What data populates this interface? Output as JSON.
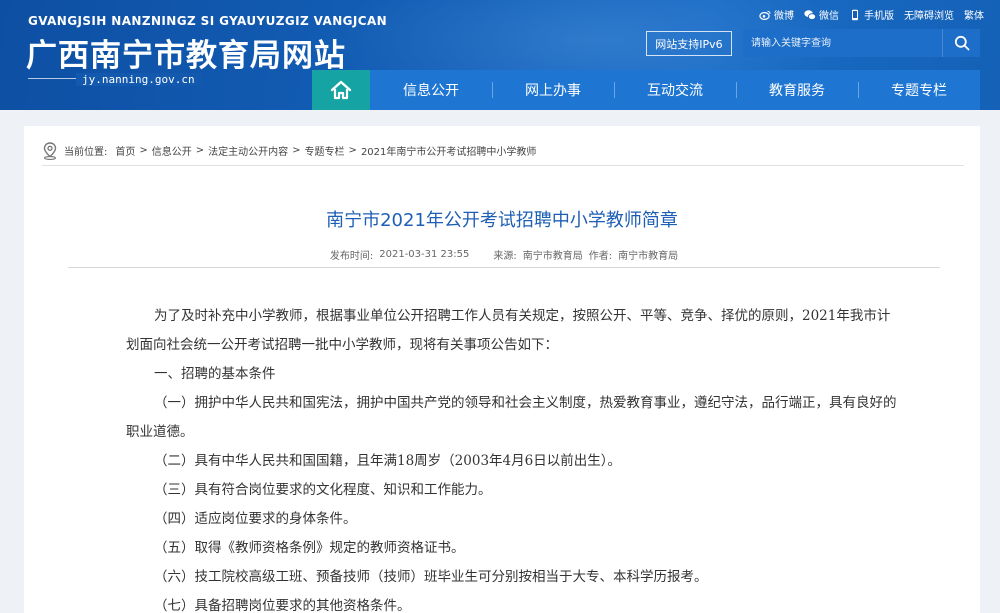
{
  "header": {
    "pinyin": "GVANGJSIH NANZNINGZ SI GYAUYUZGIZ VANGJCAN",
    "title": "广西南宁市教育局网站",
    "domain": "jy.nanning.gov.cn",
    "toplinks": [
      {
        "label": "微博",
        "icon": "weibo-icon"
      },
      {
        "label": "微信",
        "icon": "wechat-icon"
      },
      {
        "label": "手机版",
        "icon": "mobile-icon"
      },
      {
        "label": "无障碍浏览"
      },
      {
        "label": "繁体"
      }
    ],
    "ipv6": "网站支持IPv6",
    "search_placeholder": "请输入关键字查询"
  },
  "nav": {
    "home_icon": "home-icon",
    "items": [
      "信息公开",
      "网上办事",
      "互动交流",
      "教育服务",
      "专题专栏"
    ]
  },
  "breadcrumb": {
    "label": "当前位置:",
    "items": [
      "首页",
      "信息公开",
      "法定主动公开内容",
      "专题专栏",
      "2021年南宁市公开考试招聘中小学教师"
    ],
    "separator": ">"
  },
  "article": {
    "title": "南宁市2021年公开考试招聘中小学教师简章",
    "published_label": "发布时间:",
    "published": "2021-03-31 23:55",
    "source_label": "来源:",
    "source": "南宁市教育局",
    "author_label": "作者:",
    "author": "南宁市教育局",
    "paragraphs": [
      "为了及时补充中小学教师，根据事业单位公开招聘工作人员有关规定，按照公开、平等、竞争、择优的原则，2021年我市计划面向社会统一公开考试招聘一批中小学教师，现将有关事项公告如下：",
      "一、招聘的基本条件",
      "（一）拥护中华人民共和国宪法，拥护中国共产党的领导和社会主义制度，热爱教育事业，遵纪守法，品行端正，具有良好的职业道德。",
      "（二）具有中华人民共和国国籍，且年满18周岁（2003年4月6日以前出生）。",
      "（三）具有符合岗位要求的文化程度、知识和工作能力。",
      "（四）适应岗位要求的身体条件。",
      "（五）取得《教师资格条例》规定的教师资格证书。",
      "（六）技工院校高级工班、预备技师（技师）班毕业生可分别按相当于大专、本科学历报考。",
      "（七）具备招聘岗位要求的其他资格条件。"
    ]
  },
  "colors": {
    "header_blue": "#1460b8",
    "nav_blue": "#1e76d2",
    "home_teal": "#16a3a3",
    "title_blue": "#1e5fb6"
  }
}
